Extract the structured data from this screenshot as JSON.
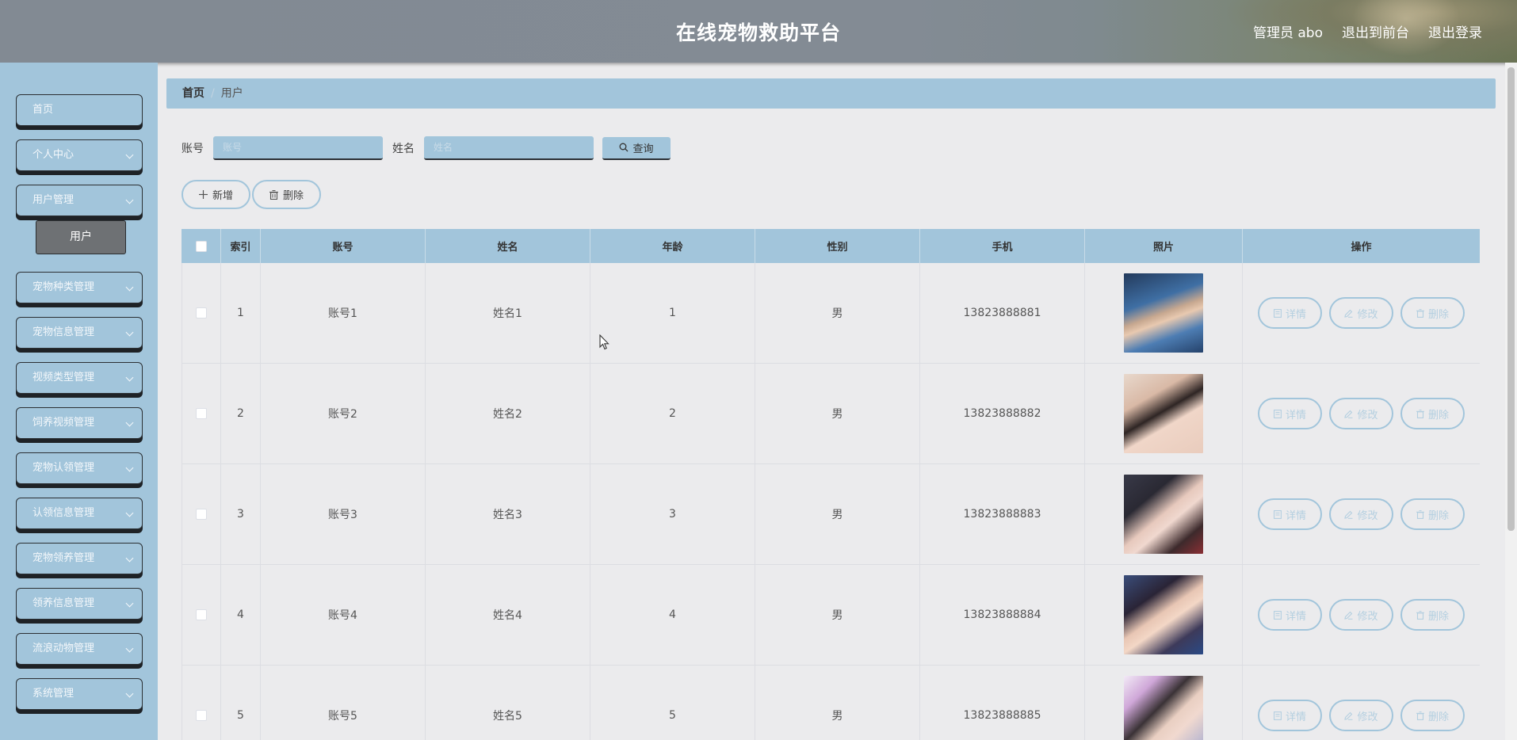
{
  "header": {
    "title": "在线宠物救助平台",
    "user_label": "管理员 abo",
    "to_front": "退出到前台",
    "logout": "退出登录"
  },
  "sidebar": {
    "items": [
      {
        "label": "首页",
        "has_children": false
      },
      {
        "label": "个人中心",
        "has_children": true
      },
      {
        "label": "用户管理",
        "has_children": true
      },
      {
        "label": "宠物种类管理",
        "has_children": true
      },
      {
        "label": "宠物信息管理",
        "has_children": true
      },
      {
        "label": "视频类型管理",
        "has_children": true
      },
      {
        "label": "饲养视频管理",
        "has_children": true
      },
      {
        "label": "宠物认领管理",
        "has_children": true
      },
      {
        "label": "认领信息管理",
        "has_children": true
      },
      {
        "label": "宠物领养管理",
        "has_children": true
      },
      {
        "label": "领养信息管理",
        "has_children": true
      },
      {
        "label": "流浪动物管理",
        "has_children": true
      },
      {
        "label": "系统管理",
        "has_children": true
      }
    ],
    "active_sub": "用户"
  },
  "breadcrumb": {
    "home": "首页",
    "separator": "/",
    "current": "用户"
  },
  "search": {
    "account_label": "账号",
    "account_placeholder": "账号",
    "name_label": "姓名",
    "name_placeholder": "姓名",
    "query_button": "查询"
  },
  "actions": {
    "add": "新增",
    "delete": "删除"
  },
  "table": {
    "headers": [
      "索引",
      "账号",
      "姓名",
      "年龄",
      "性别",
      "手机",
      "照片",
      "操作"
    ],
    "rows": [
      {
        "index": "1",
        "account": "账号1",
        "name": "姓名1",
        "age": "1",
        "gender": "男",
        "phone": "13823888881"
      },
      {
        "index": "2",
        "account": "账号2",
        "name": "姓名2",
        "age": "2",
        "gender": "男",
        "phone": "13823888882"
      },
      {
        "index": "3",
        "account": "账号3",
        "name": "姓名3",
        "age": "3",
        "gender": "男",
        "phone": "13823888883"
      },
      {
        "index": "4",
        "account": "账号4",
        "name": "姓名4",
        "age": "4",
        "gender": "男",
        "phone": "13823888884"
      },
      {
        "index": "5",
        "account": "账号5",
        "name": "姓名5",
        "age": "5",
        "gender": "男",
        "phone": "13823888885"
      }
    ],
    "row_actions": {
      "detail": "详情",
      "edit": "修改",
      "delete": "删除"
    }
  },
  "colors": {
    "accent": "#a2c5db",
    "background": "#ebebed",
    "header": "#838b94"
  }
}
